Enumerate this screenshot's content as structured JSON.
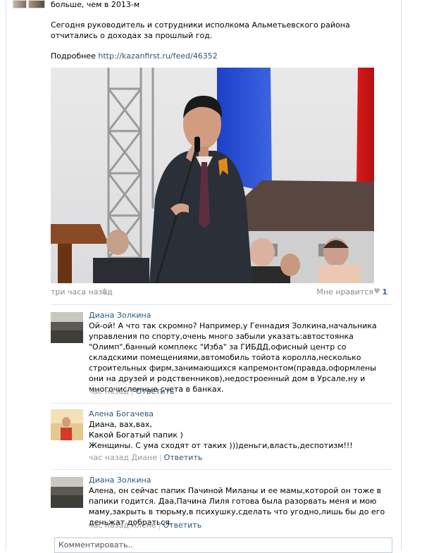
{
  "post": {
    "top_line": "больше, чем в 2013-м",
    "text": "Сегодня руководитель и сотрудники исполкома Альметьевского района отчитались о доходах за прошлый год.",
    "more_label": "Подробнее",
    "more_link": "http://kazanfirst.ru/feed/46352",
    "time": "три часа назад",
    "like_label": "Мне нравится",
    "like_count": "1"
  },
  "comments": [
    {
      "author": "Диана Золкина",
      "text": "Ой-ой! А что так скромно? Например,у Геннадия Золкина,начальника управления по спорту,очень много забыли указать:автостоянка \"Олимп\",банный комплекс \"Изба\" за ГИБДД,офисный центр со складскими помещениями,автомобиль тойота королла,несколько строительных фирм,занимающихся капремонтом(правда,оформлены они на друзей и родственников),недостроенный дом в Урсале,ну и многочисленные счета в банках.",
      "time": "час назад",
      "reply": "Ответить"
    },
    {
      "author": "Алена Богачева",
      "text": "Диана, вах,вах,\nКакой Богатый папик )\nЖенщины. С ума сходят от таких )))деньги,власть,деспотизм!!!",
      "time": "час назад Диане",
      "reply": "Ответить"
    },
    {
      "author": "Диана Золкина",
      "text": "Алена, он сейчас папик Пачиной Миланы и ее мамы,которой он тоже в папики годится. Даа,Пачина Лиля готова была разорвать меня и мою маму,закрыть в тюрьму,в психушку,сделать что угодно,лишь бы до его деньжат добраться.",
      "time": "час назад Алене",
      "reply": "Ответить"
    }
  ],
  "comment_input": {
    "placeholder": "Комментировать.."
  },
  "icons": {
    "settings": "gear-icon",
    "like": "heart-icon"
  },
  "colors": {
    "link": "#2b587a",
    "meta": "#8a8a8a",
    "divider": "#e4e8ec"
  }
}
